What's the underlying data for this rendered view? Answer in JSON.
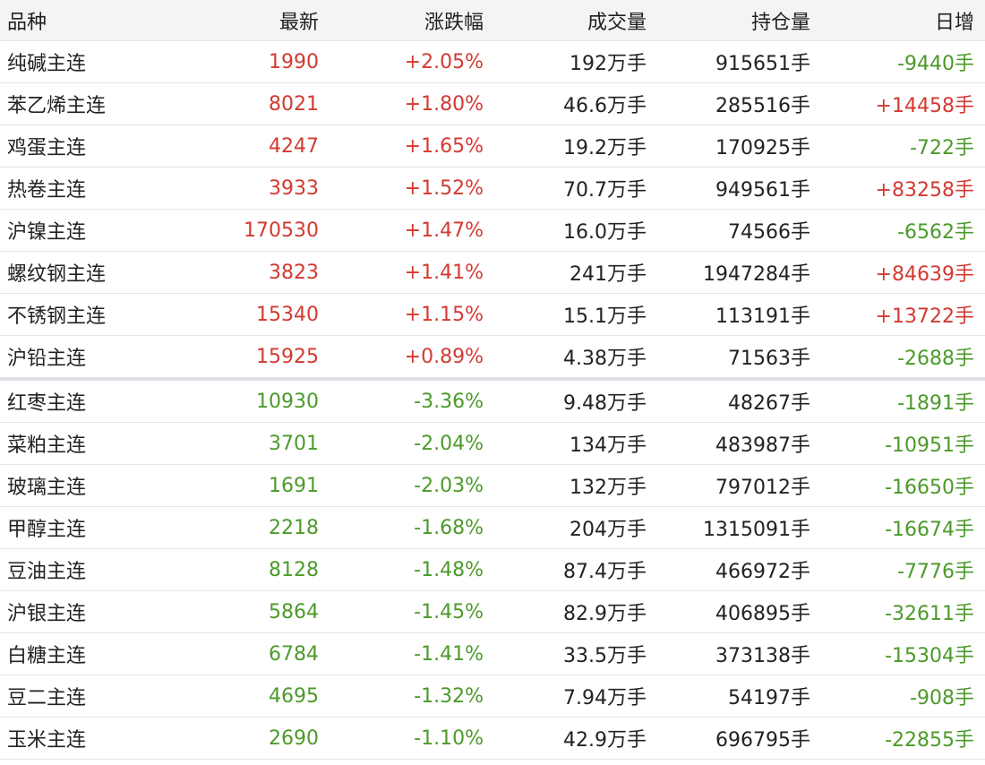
{
  "colors": {
    "up": "#d23a32",
    "down": "#4c9a2a",
    "header_bg": "#f3f4f6"
  },
  "header": {
    "name": "品种",
    "last": "最新",
    "change": "涨跌幅",
    "volume": "成交量",
    "open_interest": "持仓量",
    "daily_change": "日增"
  },
  "gainers": [
    {
      "name": "纯碱主连",
      "last": "1990",
      "change": "+2.05%",
      "volume": "192万手",
      "open_interest": "915651手",
      "daily_change": "-9440手",
      "day_dir": "down"
    },
    {
      "name": "苯乙烯主连",
      "last": "8021",
      "change": "+1.80%",
      "volume": "46.6万手",
      "open_interest": "285516手",
      "daily_change": "+14458手",
      "day_dir": "up"
    },
    {
      "name": "鸡蛋主连",
      "last": "4247",
      "change": "+1.65%",
      "volume": "19.2万手",
      "open_interest": "170925手",
      "daily_change": "-722手",
      "day_dir": "down"
    },
    {
      "name": "热卷主连",
      "last": "3933",
      "change": "+1.52%",
      "volume": "70.7万手",
      "open_interest": "949561手",
      "daily_change": "+83258手",
      "day_dir": "up"
    },
    {
      "name": "沪镍主连",
      "last": "170530",
      "change": "+1.47%",
      "volume": "16.0万手",
      "open_interest": "74566手",
      "daily_change": "-6562手",
      "day_dir": "down"
    },
    {
      "name": "螺纹钢主连",
      "last": "3823",
      "change": "+1.41%",
      "volume": "241万手",
      "open_interest": "1947284手",
      "daily_change": "+84639手",
      "day_dir": "up"
    },
    {
      "name": "不锈钢主连",
      "last": "15340",
      "change": "+1.15%",
      "volume": "15.1万手",
      "open_interest": "113191手",
      "daily_change": "+13722手",
      "day_dir": "up"
    },
    {
      "name": "沪铅主连",
      "last": "15925",
      "change": "+0.89%",
      "volume": "4.38万手",
      "open_interest": "71563手",
      "daily_change": "-2688手",
      "day_dir": "down"
    }
  ],
  "losers": [
    {
      "name": "红枣主连",
      "last": "10930",
      "change": "-3.36%",
      "volume": "9.48万手",
      "open_interest": "48267手",
      "daily_change": "-1891手",
      "day_dir": "down"
    },
    {
      "name": "菜粕主连",
      "last": "3701",
      "change": "-2.04%",
      "volume": "134万手",
      "open_interest": "483987手",
      "daily_change": "-10951手",
      "day_dir": "down"
    },
    {
      "name": "玻璃主连",
      "last": "1691",
      "change": "-2.03%",
      "volume": "132万手",
      "open_interest": "797012手",
      "daily_change": "-16650手",
      "day_dir": "down"
    },
    {
      "name": "甲醇主连",
      "last": "2218",
      "change": "-1.68%",
      "volume": "204万手",
      "open_interest": "1315091手",
      "daily_change": "-16674手",
      "day_dir": "down"
    },
    {
      "name": "豆油主连",
      "last": "8128",
      "change": "-1.48%",
      "volume": "87.4万手",
      "open_interest": "466972手",
      "daily_change": "-7776手",
      "day_dir": "down"
    },
    {
      "name": "沪银主连",
      "last": "5864",
      "change": "-1.45%",
      "volume": "82.9万手",
      "open_interest": "406895手",
      "daily_change": "-32611手",
      "day_dir": "down"
    },
    {
      "name": "白糖主连",
      "last": "6784",
      "change": "-1.41%",
      "volume": "33.5万手",
      "open_interest": "373138手",
      "daily_change": "-15304手",
      "day_dir": "down"
    },
    {
      "name": "豆二主连",
      "last": "4695",
      "change": "-1.32%",
      "volume": "7.94万手",
      "open_interest": "54197手",
      "daily_change": "-908手",
      "day_dir": "down"
    },
    {
      "name": "玉米主连",
      "last": "2690",
      "change": "-1.10%",
      "volume": "42.9万手",
      "open_interest": "696795手",
      "daily_change": "-22855手",
      "day_dir": "down"
    }
  ]
}
